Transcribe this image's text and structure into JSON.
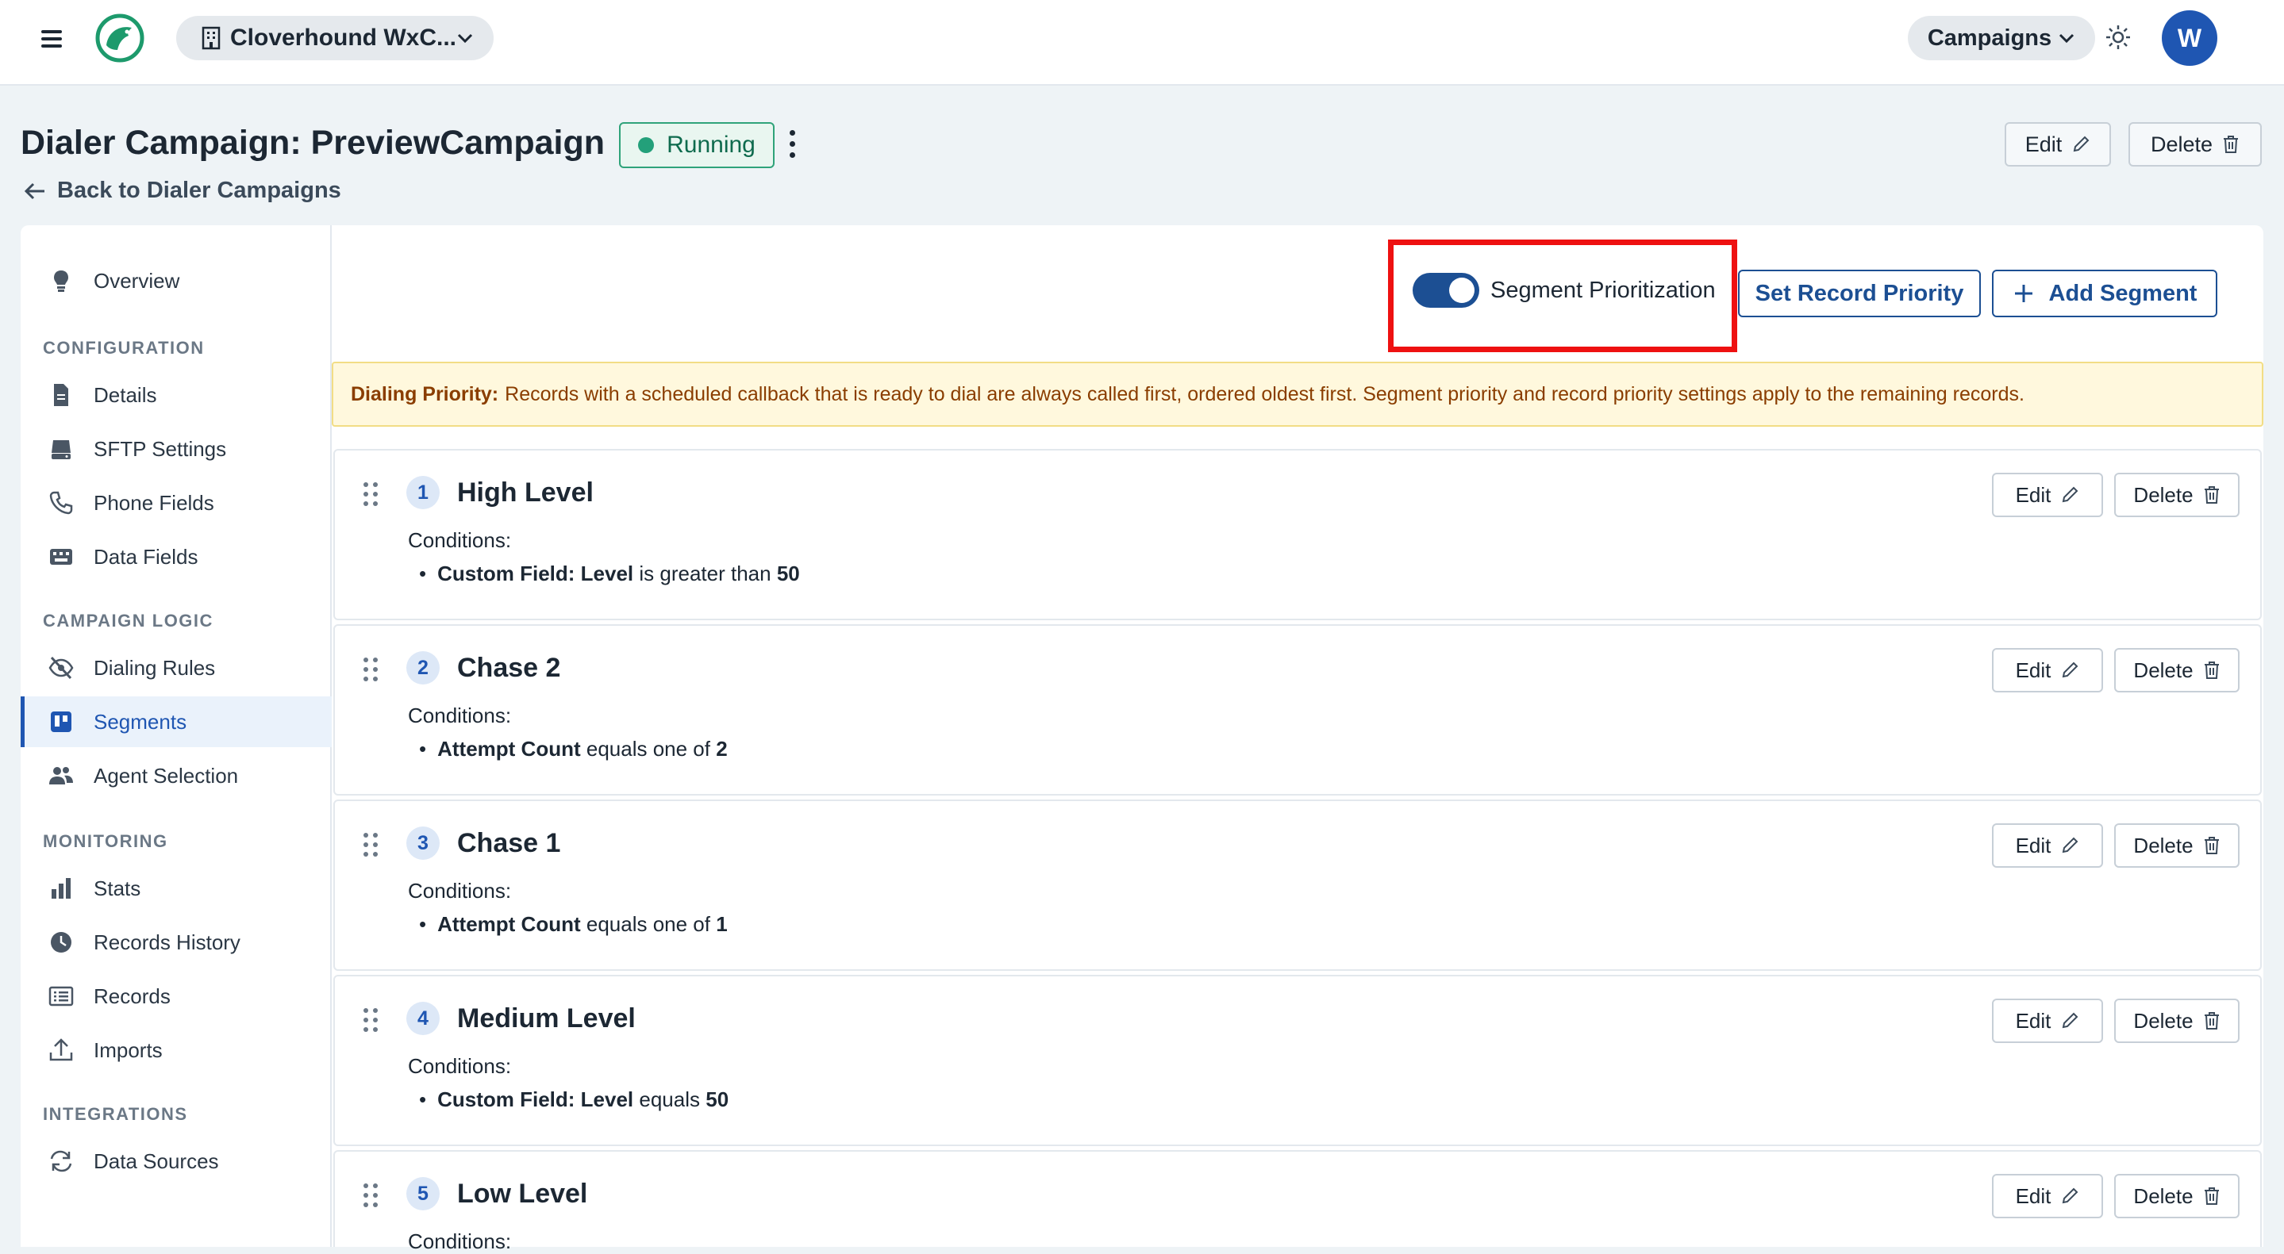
{
  "topbar": {
    "workspace_name": "Cloverhound WxC...",
    "nav_menu_label": "Campaigns",
    "avatar_initial": "W"
  },
  "header": {
    "title": "Dialer Campaign: PreviewCampaign",
    "status": "Running",
    "back_link": "Back to Dialer Campaigns",
    "edit_label": "Edit",
    "delete_label": "Delete"
  },
  "sidebar": {
    "overview": "Overview",
    "sections": {
      "configuration": "CONFIGURATION",
      "campaign_logic": "CAMPAIGN LOGIC",
      "monitoring": "MONITORING",
      "integrations": "INTEGRATIONS"
    },
    "items": {
      "details": "Details",
      "sftp": "SFTP Settings",
      "phone_fields": "Phone Fields",
      "data_fields": "Data Fields",
      "dialing_rules": "Dialing Rules",
      "segments": "Segments",
      "agent_selection": "Agent Selection",
      "stats": "Stats",
      "records_history": "Records History",
      "records": "Records",
      "imports": "Imports",
      "data_sources": "Data Sources"
    }
  },
  "toolbar": {
    "toggle_label": "Segment Prioritization",
    "toggle_on": true,
    "set_record_priority": "Set Record Priority",
    "add_segment": "Add Segment"
  },
  "alert": {
    "title": "Dialing Priority:",
    "text": "Records with a scheduled callback that is ready to dial are always called first, ordered oldest first. Segment priority and record priority settings apply to the remaining records."
  },
  "segments": {
    "conditions_label": "Conditions:",
    "edit_label": "Edit",
    "delete_label": "Delete",
    "items": [
      {
        "number": "1",
        "name": "High Level",
        "field": "Custom Field: Level",
        "operator": "is greater than",
        "value": "50"
      },
      {
        "number": "2",
        "name": "Chase 2",
        "field": "Attempt Count",
        "operator": "equals one of",
        "value": "2"
      },
      {
        "number": "3",
        "name": "Chase 1",
        "field": "Attempt Count",
        "operator": "equals one of",
        "value": "1"
      },
      {
        "number": "4",
        "name": "Medium Level",
        "field": "Custom Field: Level",
        "operator": "equals",
        "value": "50"
      },
      {
        "number": "5",
        "name": "Low Level"
      }
    ]
  },
  "colors": {
    "accent": "#1f56b2",
    "primary_button": "#1c4f93",
    "status_green": "#23a07a",
    "highlight_red": "#ee1111",
    "alert_bg": "#fff8dd"
  },
  "icons": {
    "menu": "hamburger-icon",
    "logo": "bird-logo-icon",
    "building": "building-icon",
    "theme": "sun-icon",
    "back": "arrow-left-icon",
    "edit": "pencil-icon",
    "delete": "trash-icon",
    "drag": "drag-handle-icon",
    "add": "plus-icon"
  }
}
